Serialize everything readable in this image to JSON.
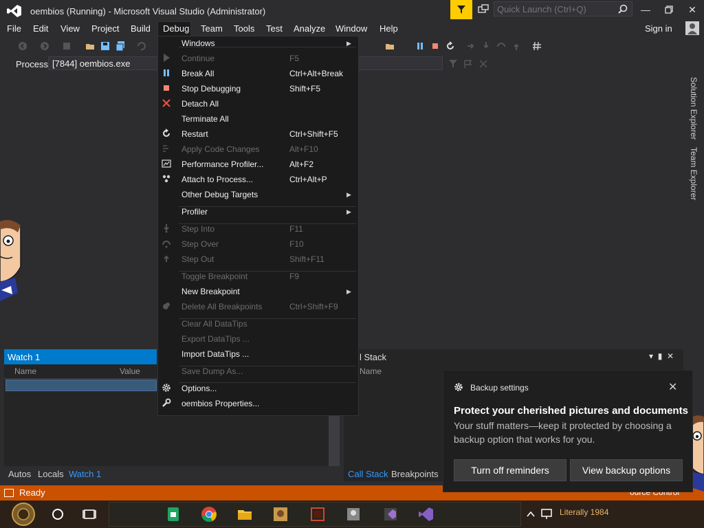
{
  "window": {
    "title": "oembios (Running) - Microsoft Visual Studio  (Administrator)",
    "quick_launch_placeholder": "Quick Launch (Ctrl+Q)",
    "signin": "Sign in"
  },
  "menubar": {
    "items": [
      "File",
      "Edit",
      "View",
      "Project",
      "Build",
      "Debug",
      "Team",
      "Tools",
      "Test",
      "Analyze",
      "Window",
      "Help"
    ]
  },
  "toolbar": {
    "process_label": "Process:",
    "process_value": "[7844] oembios.exe"
  },
  "right_tabs": [
    "Solution Explorer",
    "Team Explorer"
  ],
  "debug_menu": {
    "items": [
      {
        "label": "Windows",
        "shortcut": "",
        "enabled": true,
        "submenu": true,
        "icon": ""
      },
      {
        "label": "Continue",
        "shortcut": "F5",
        "enabled": false,
        "submenu": false,
        "icon": "play-icon"
      },
      {
        "label": "Break All",
        "shortcut": "Ctrl+Alt+Break",
        "enabled": true,
        "submenu": false,
        "icon": "pause-icon"
      },
      {
        "label": "Stop Debugging",
        "shortcut": "Shift+F5",
        "enabled": true,
        "submenu": false,
        "icon": "stop-icon"
      },
      {
        "label": "Detach All",
        "shortcut": "",
        "enabled": true,
        "submenu": false,
        "icon": "detach-icon"
      },
      {
        "label": "Terminate All",
        "shortcut": "",
        "enabled": true,
        "submenu": false,
        "icon": ""
      },
      {
        "label": "Restart",
        "shortcut": "Ctrl+Shift+F5",
        "enabled": true,
        "submenu": false,
        "icon": "restart-icon"
      },
      {
        "label": "Apply Code Changes",
        "shortcut": "Alt+F10",
        "enabled": false,
        "submenu": false,
        "icon": "apply-code-icon"
      },
      {
        "label": "Performance Profiler...",
        "shortcut": "Alt+F2",
        "enabled": true,
        "submenu": false,
        "icon": "profiler-icon"
      },
      {
        "label": "Attach to Process...",
        "shortcut": "Ctrl+Alt+P",
        "enabled": true,
        "submenu": false,
        "icon": "attach-icon"
      },
      {
        "label": "Other Debug Targets",
        "shortcut": "",
        "enabled": true,
        "submenu": true,
        "icon": ""
      },
      {
        "label": "Profiler",
        "shortcut": "",
        "enabled": true,
        "submenu": true,
        "icon": ""
      },
      {
        "label": "Step Into",
        "shortcut": "F11",
        "enabled": false,
        "submenu": false,
        "icon": "step-into-icon"
      },
      {
        "label": "Step Over",
        "shortcut": "F10",
        "enabled": false,
        "submenu": false,
        "icon": "step-over-icon"
      },
      {
        "label": "Step Out",
        "shortcut": "Shift+F11",
        "enabled": false,
        "submenu": false,
        "icon": "step-out-icon"
      },
      {
        "label": "Toggle Breakpoint",
        "shortcut": "F9",
        "enabled": false,
        "submenu": false,
        "icon": ""
      },
      {
        "label": "New Breakpoint",
        "shortcut": "",
        "enabled": true,
        "submenu": true,
        "icon": ""
      },
      {
        "label": "Delete All Breakpoints",
        "shortcut": "Ctrl+Shift+F9",
        "enabled": false,
        "submenu": false,
        "icon": "delete-breakpoints-icon"
      },
      {
        "label": "Clear All DataTips",
        "shortcut": "",
        "enabled": false,
        "submenu": false,
        "icon": ""
      },
      {
        "label": "Export DataTips ...",
        "shortcut": "",
        "enabled": false,
        "submenu": false,
        "icon": ""
      },
      {
        "label": "Import DataTips ...",
        "shortcut": "",
        "enabled": true,
        "submenu": false,
        "icon": ""
      },
      {
        "label": "Save Dump As...",
        "shortcut": "",
        "enabled": false,
        "submenu": false,
        "icon": ""
      },
      {
        "label": "Options...",
        "shortcut": "",
        "enabled": true,
        "submenu": false,
        "icon": "gear-icon"
      },
      {
        "label": "oembios Properties...",
        "shortcut": "",
        "enabled": true,
        "submenu": false,
        "icon": "wrench-icon"
      }
    ]
  },
  "watch_panel": {
    "title": "Watch 1",
    "col_name": "Name",
    "col_value": "Value",
    "tabs": [
      "Autos",
      "Locals",
      "Watch 1"
    ]
  },
  "callstack_panel": {
    "title": "l Stack",
    "col_name": "Name",
    "tabs": [
      "Call Stack",
      "Breakpoints"
    ]
  },
  "statusbar": {
    "text": "Ready",
    "source_control": "ource Control"
  },
  "toast": {
    "app": "Backup settings",
    "title": "Protect your cherished pictures and documents",
    "body": "Your stuff matters—keep it protected by choosing a backup option that works for you.",
    "btn_off": "Turn off reminders",
    "btn_view": "View backup options"
  },
  "taskbar": {
    "clock_text": "Literally 1984"
  },
  "colors": {
    "accent": "#007acc",
    "status": "#ca5100",
    "menu_bg": "#1b1b1c",
    "stop": "#f48771",
    "pause": "#75beff",
    "detach": "#e85040"
  }
}
